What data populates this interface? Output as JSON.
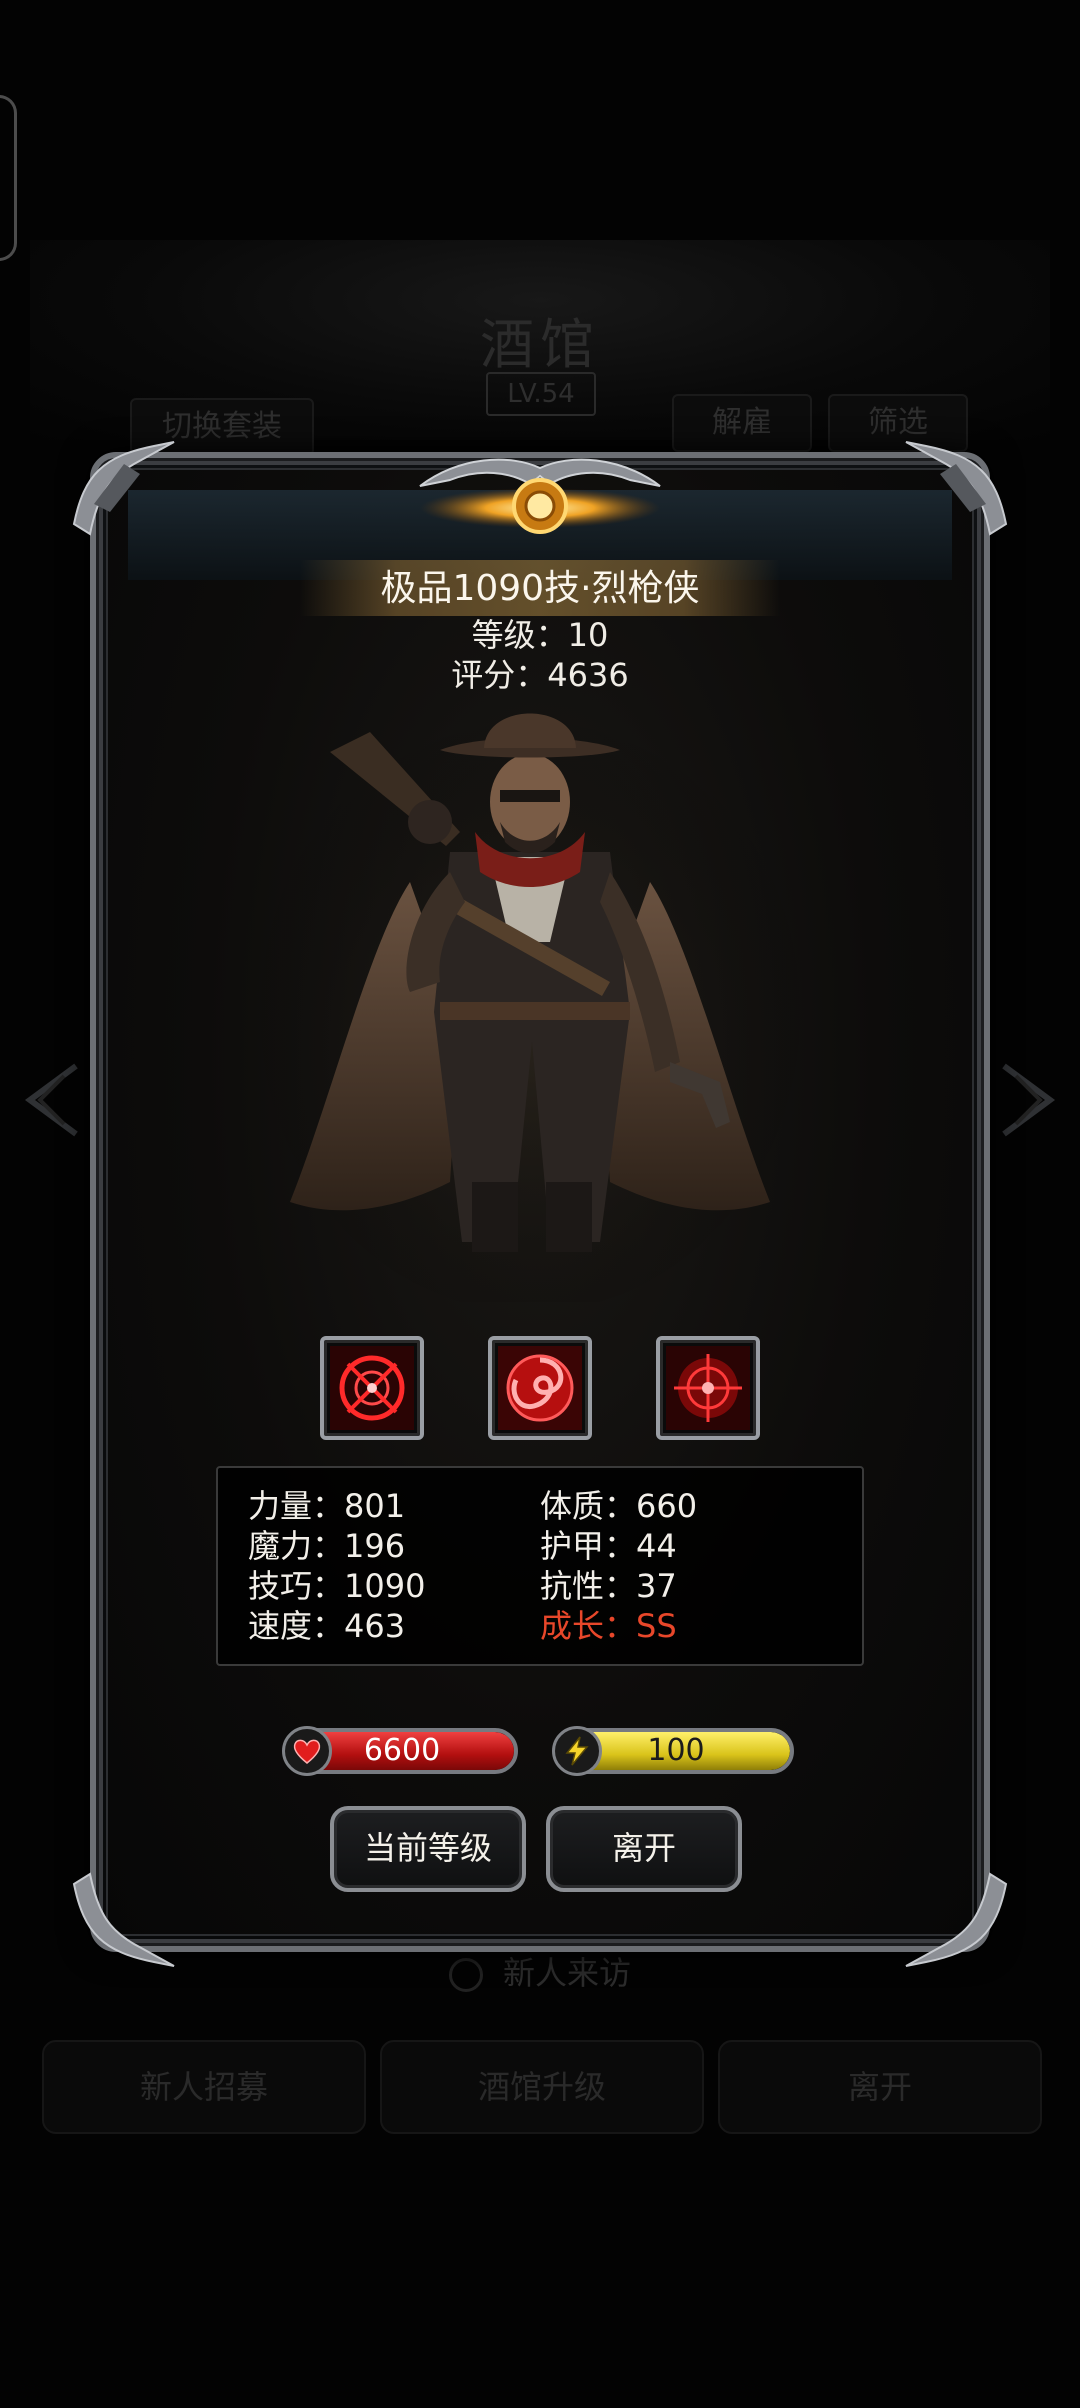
{
  "background": {
    "title": "酒馆",
    "level": "LV.54",
    "switch_outfit": "切换套装",
    "dismiss": "解雇",
    "filter": "筛选",
    "new_visitor": "新人来访",
    "bottom_buttons": [
      "新人招募",
      "酒馆升级",
      "离开"
    ]
  },
  "hero": {
    "name": "极品1090技·烈枪侠",
    "level_line": "等级：10",
    "score_line": "评分：4636"
  },
  "skills": [
    "crosshair-skill-icon",
    "vortex-skill-icon",
    "target-skill-icon"
  ],
  "stats": {
    "left": [
      "力量：801",
      "魔力：196",
      "技巧：1090",
      "速度：463"
    ],
    "right": [
      "体质：660",
      "护甲：44",
      "抗性：37"
    ],
    "growth": "成长：SS"
  },
  "bars": {
    "hp": "6600",
    "energy": "100",
    "hp_color": "#d01c1c",
    "energy_color": "#e2d21a"
  },
  "buttons": {
    "current_level": "当前等级",
    "leave": "离开"
  }
}
